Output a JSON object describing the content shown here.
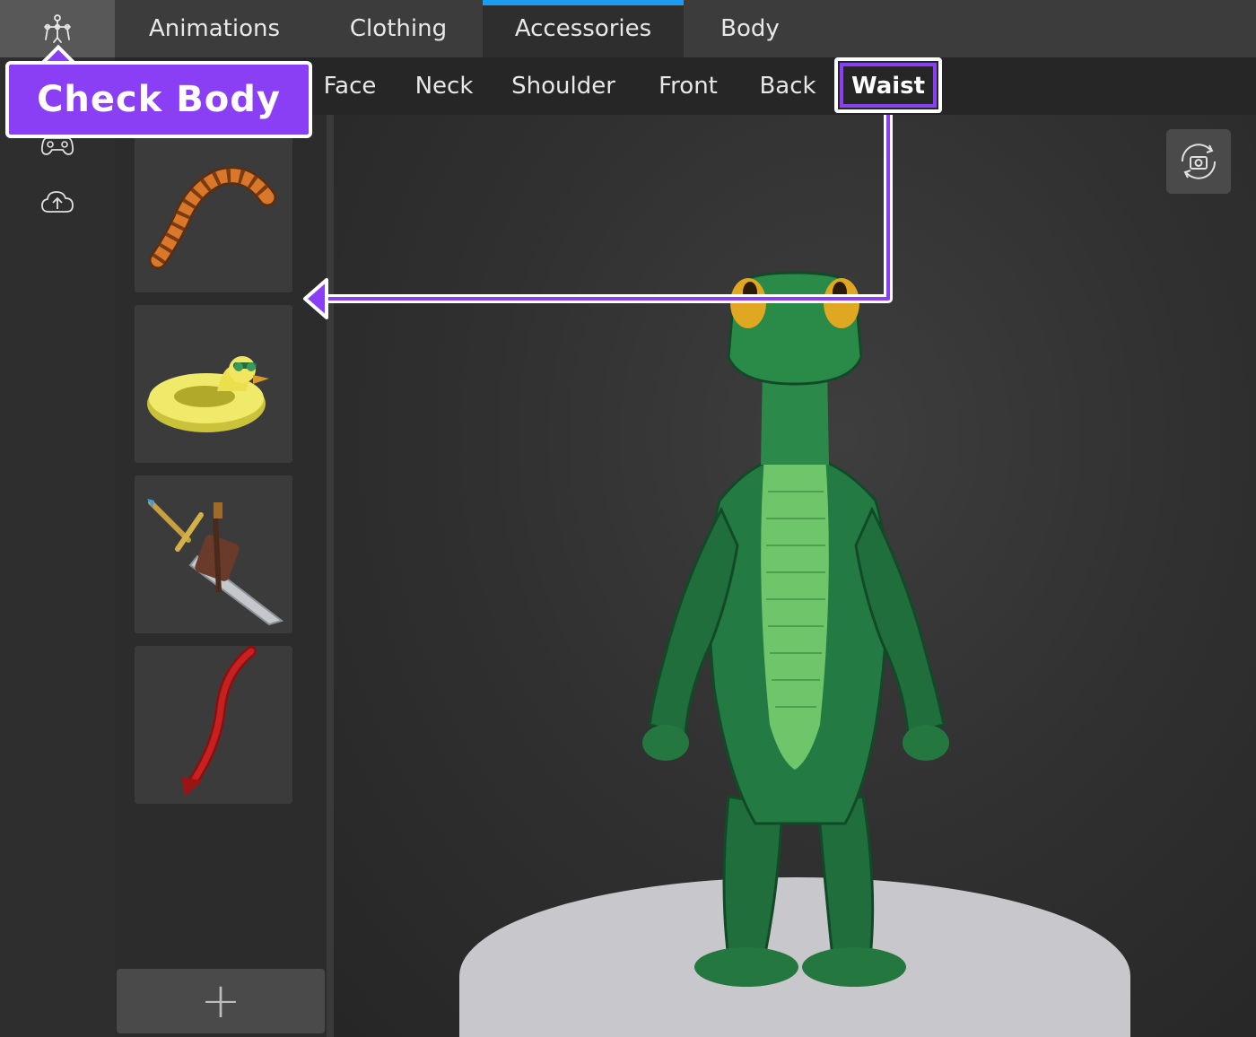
{
  "top_tabs": [
    {
      "label": "Animations",
      "active": false
    },
    {
      "label": "Clothing",
      "active": false
    },
    {
      "label": "Accessories",
      "active": true
    },
    {
      "label": "Body",
      "active": false
    }
  ],
  "sub_tabs": [
    {
      "label": "Face",
      "active": false
    },
    {
      "label": "Neck",
      "active": false
    },
    {
      "label": "Shoulder",
      "active": false
    },
    {
      "label": "Front",
      "active": false
    },
    {
      "label": "Back",
      "active": false
    },
    {
      "label": "Waist",
      "active": true
    }
  ],
  "rail": {
    "icons": [
      "rig-icon",
      "gamepad-icon",
      "cloud-upload-icon"
    ]
  },
  "items": [
    {
      "name": "tail-item",
      "icon": "tiger-tail"
    },
    {
      "name": "duck-floatie-item",
      "icon": "duck-pool-float"
    },
    {
      "name": "sword-sheath-item",
      "icon": "sword-with-sheath"
    },
    {
      "name": "devil-tail-item",
      "icon": "red-devil-tail"
    }
  ],
  "add_button": {
    "label": "+"
  },
  "callout": {
    "text": "Check Body"
  },
  "colors": {
    "accent_purple": "#8a3ff5",
    "active_tab_bar": "#1d9bf0",
    "lizard_green": "#2d8a4a",
    "platform": "#c8c8cc"
  }
}
